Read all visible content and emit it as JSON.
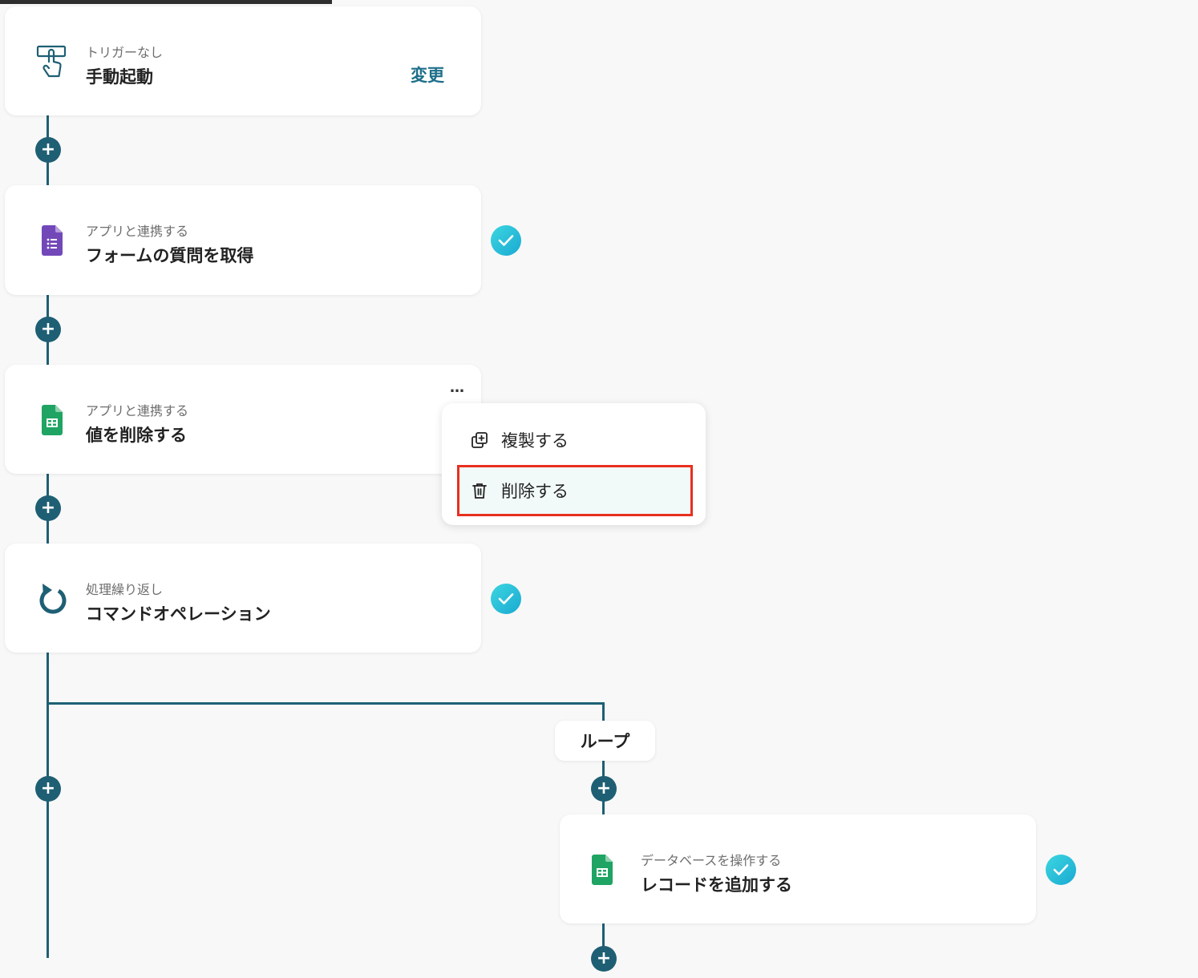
{
  "steps": [
    {
      "subtitle": "トリガーなし",
      "title": "手動起動",
      "action": "変更",
      "icon": "hand-pointer-icon"
    },
    {
      "subtitle": "アプリと連携する",
      "title": "フォームの質問を取得",
      "icon": "google-forms-icon",
      "status": "complete"
    },
    {
      "subtitle": "アプリと連携する",
      "title": "値を削除する",
      "icon": "google-sheets-icon",
      "more": "…"
    },
    {
      "subtitle": "処理繰り返し",
      "title": "コマンドオペレーション",
      "icon": "loop-arrow-icon",
      "status": "complete"
    }
  ],
  "context_menu": {
    "items": [
      {
        "label": "複製する",
        "icon": "duplicate-icon"
      },
      {
        "label": "削除する",
        "icon": "trash-icon",
        "highlighted": true
      }
    ]
  },
  "loop": {
    "label": "ループ",
    "step": {
      "subtitle": "データベースを操作する",
      "title": "レコードを追加する",
      "icon": "google-sheets-icon",
      "status": "complete"
    }
  },
  "colors": {
    "connector": "#1e5f74",
    "accent_link": "#1e6f8a",
    "check": "#22b8d8",
    "highlight_border": "#e8301f",
    "forms_purple": "#7248b9",
    "sheets_green": "#1fa463"
  }
}
